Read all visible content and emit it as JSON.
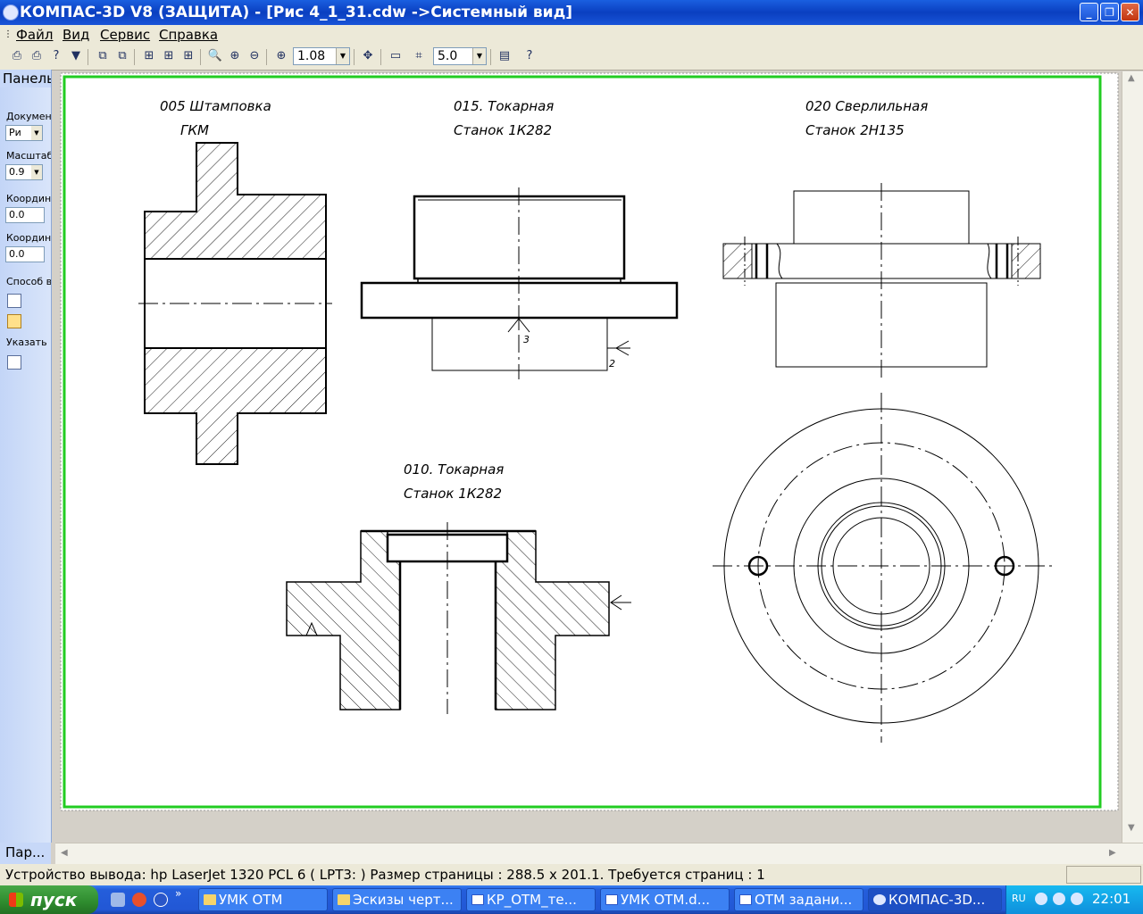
{
  "window": {
    "title": "КОМПАС-3D V8 (ЗАЩИТА) - [Рис 4_1_31.cdw ->Системный вид]"
  },
  "menu": [
    "Файл",
    "Вид",
    "Сервис",
    "Справка"
  ],
  "toolbar": {
    "zoom_value": "1.08",
    "step_value": "5.0"
  },
  "left_panel": {
    "header": "Панель",
    "doc_label": "Докумен",
    "doc_value": "Ри",
    "scale_label": "Масштаб",
    "scale_value": "0.9",
    "coord1_label": "Координ",
    "coord1_value": "0.0",
    "coord2_label": "Координ",
    "coord2_value": "0.0",
    "method_label": "Способ в",
    "point_label": "Указать",
    "footer": "Пар..."
  },
  "drawing": {
    "op005_title": "005 Штамповка",
    "op005_machine": "ГКМ",
    "op015_title": "015. Токарная",
    "op015_machine": "Станок 1К282",
    "op020_title": "020 Сверлильная",
    "op020_machine": "Станок 2Н135",
    "op010_title": "010. Токарная",
    "op010_machine": "Станок 1К282",
    "mark_3": "3",
    "mark_2": "2"
  },
  "status": {
    "text": "Устройство вывода: hp LaserJet 1320 PCL 6 ( LPT3: )  Размер страницы : 288.5 x 201.1.  Требуется страниц : 1"
  },
  "taskbar": {
    "start": "пуск",
    "tasks": [
      "УМК ОТМ",
      "Эскизы черт...",
      "КР_ОТМ_те...",
      "УМК ОТМ.d...",
      "ОТМ задани...",
      "КОМПАС-3D..."
    ],
    "lang": "RU",
    "clock": "22:01"
  }
}
